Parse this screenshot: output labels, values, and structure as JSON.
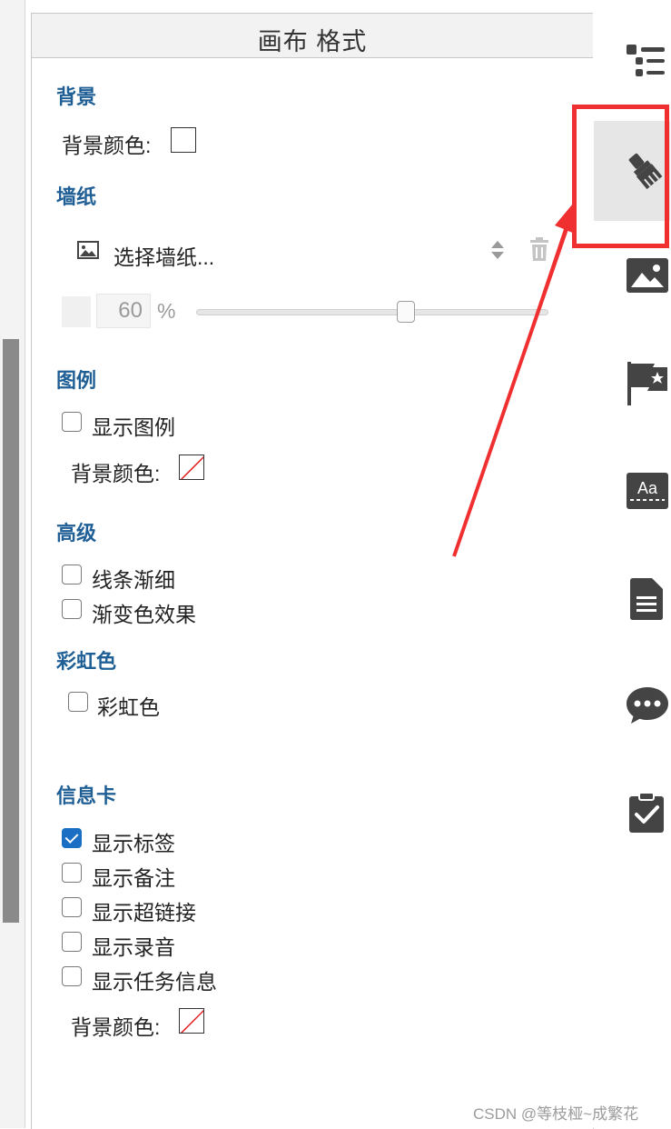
{
  "panel": {
    "title": "画布 格式"
  },
  "background": {
    "title": "背景",
    "color_label": "背景颜色:",
    "color": "#ffffff"
  },
  "wallpaper": {
    "title": "墙纸",
    "select_label": "选择墙纸...",
    "opacity_value": "60",
    "opacity_unit": "%",
    "opacity_percent": 60
  },
  "legend": {
    "title": "图例",
    "show_label": "显示图例",
    "show_checked": false,
    "color_label": "背景颜色:"
  },
  "advanced": {
    "title": "高级",
    "taper_label": "线条渐细",
    "taper_checked": false,
    "gradient_label": "渐变色效果",
    "gradient_checked": false
  },
  "rainbow": {
    "title": "彩虹色",
    "label": "彩虹色",
    "checked": false
  },
  "infocard": {
    "title": "信息卡",
    "items": [
      {
        "label": "显示标签",
        "checked": true
      },
      {
        "label": "显示备注",
        "checked": false
      },
      {
        "label": "显示超链接",
        "checked": false
      },
      {
        "label": "显示录音",
        "checked": false
      },
      {
        "label": "显示任务信息",
        "checked": false
      }
    ],
    "color_label": "背景颜色:"
  },
  "toolbar": {
    "items": [
      {
        "icon": "outline-list-icon",
        "active": false
      },
      {
        "icon": "paintbrush-icon",
        "active": true
      },
      {
        "icon": "image-icon",
        "active": false
      },
      {
        "icon": "flag-star-icon",
        "active": false
      },
      {
        "icon": "text-style-icon",
        "active": false
      },
      {
        "icon": "document-icon",
        "active": false
      },
      {
        "icon": "comment-icon",
        "active": false
      },
      {
        "icon": "clipboard-check-icon",
        "active": false
      }
    ]
  },
  "colors": {
    "accent": "#1f5f95",
    "checkbox_checked": "#1a6fc4",
    "annotation": "#f03030",
    "icon": "#444444"
  },
  "watermark": "CSDN @等枝桠~成繁花"
}
